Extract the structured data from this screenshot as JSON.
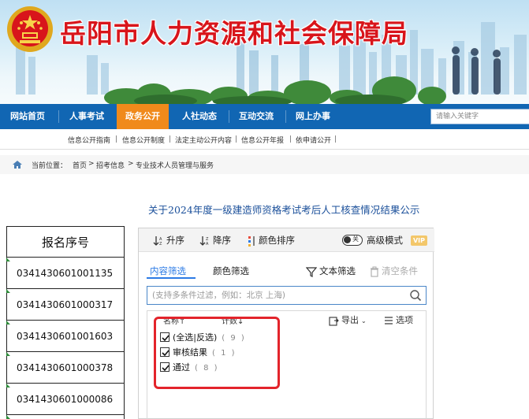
{
  "site": {
    "title": "岳阳市人力资源和社会保障局"
  },
  "nav": {
    "items": [
      "网站首页",
      "人事考试",
      "政务公开",
      "人社动态",
      "互动交流",
      "网上办事"
    ],
    "active_index": 2,
    "search_placeholder": "请输入关键字"
  },
  "subnav": {
    "items": [
      "信息公开指南",
      "信息公开制度",
      "法定主动公开内容",
      "信息公开年报",
      "依申请公开"
    ]
  },
  "breadcrumb": {
    "label": "当前位置：",
    "items": [
      "首页",
      "招考信息",
      "专业技术人员管理与服务"
    ],
    "separator": ">"
  },
  "article": {
    "title": "关于2024年度一级建造师资格考试考后人工核查情况结果公示"
  },
  "table": {
    "header": "报名序号",
    "rows": [
      "0341430601001135",
      "0341430601000317",
      "0341430601001603",
      "0341430601000378",
      "0341430601000086"
    ]
  },
  "filter_panel": {
    "toolbar": {
      "sort_asc": "升序",
      "sort_desc": "降序",
      "sort_color": "颜色排序",
      "toggle_label": "关",
      "advanced_mode": "高级模式",
      "vip_badge": "VIP"
    },
    "tabs": {
      "content_filter": "内容筛选",
      "color_filter": "颜色筛选",
      "text_filter": "文本筛选",
      "clear": "清空条件"
    },
    "search_placeholder": "(支持多条件过滤，例如：北京 上海)",
    "list_header": {
      "name_col": "名称↑",
      "count_col": "计数↓",
      "export": "导出",
      "options": "选项"
    },
    "items": [
      {
        "label": "(全选|反选)",
        "count": "( 9 )"
      },
      {
        "label": "审核结果",
        "count": "( 1 )"
      },
      {
        "label": "通过",
        "count": "( 8 )"
      }
    ]
  },
  "colors": {
    "nav_bg": "#1166b3",
    "nav_active": "#f08a1b",
    "title_red": "#d8151b",
    "accent_blue": "#2c7be5",
    "highlight_red": "#e3242b"
  }
}
